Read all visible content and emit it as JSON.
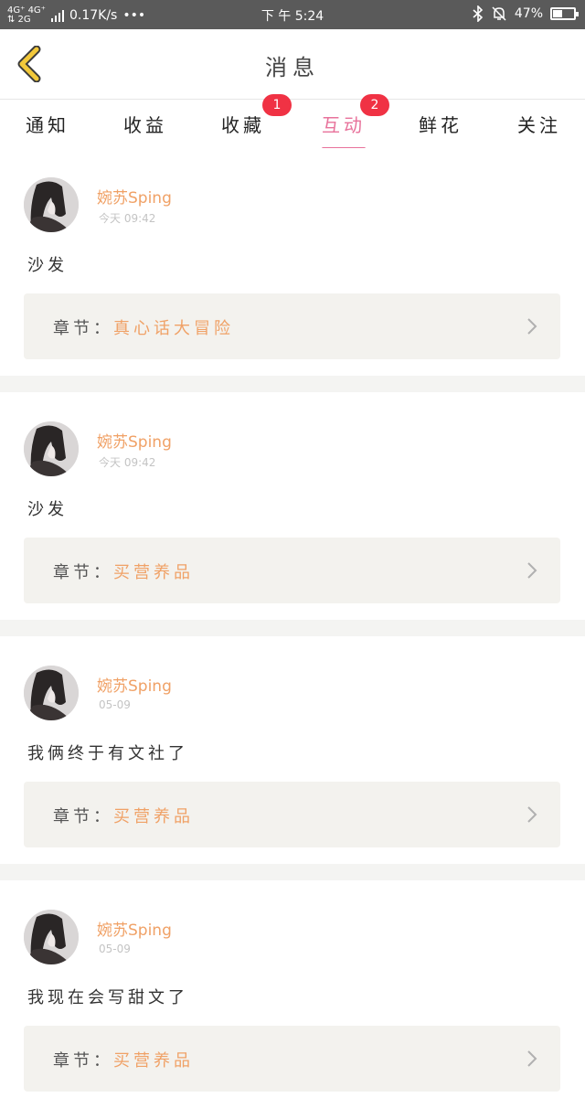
{
  "status_bar": {
    "network_top": "4G⁺ 4G⁺",
    "network_bottom": "⇅ 2G",
    "speed": "0.17K/s",
    "dots": "•••",
    "time": "下 午 5:24",
    "battery": "47%",
    "battery_level": 0.47
  },
  "header": {
    "title": "消息"
  },
  "tabs": [
    {
      "label": "通知"
    },
    {
      "label": "收益"
    },
    {
      "label": "收藏",
      "badge": "1"
    },
    {
      "label": "互动",
      "badge": "2",
      "active": true
    },
    {
      "label": "鲜花"
    },
    {
      "label": "关注"
    }
  ],
  "messages": [
    {
      "user": "婉苏Sping",
      "time": "今天 09:42",
      "text": "沙发",
      "chapter_label": "章节：",
      "chapter": "真心话大冒险"
    },
    {
      "user": "婉苏Sping",
      "time": "今天 09:42",
      "text": "沙发",
      "chapter_label": "章节：",
      "chapter": "买营养品"
    },
    {
      "user": "婉苏Sping",
      "time": "05-09",
      "text": "我俩终于有文社了",
      "chapter_label": "章节：",
      "chapter": "买营养品"
    },
    {
      "user": "婉苏Sping",
      "time": "05-09",
      "text": "我现在会写甜文了",
      "chapter_label": "章节：",
      "chapter": "买营养品"
    }
  ],
  "colors": {
    "accent": "#e8729b",
    "username": "#f0a166",
    "badge": "#f03244",
    "back_arrow": "#f2c83a"
  }
}
